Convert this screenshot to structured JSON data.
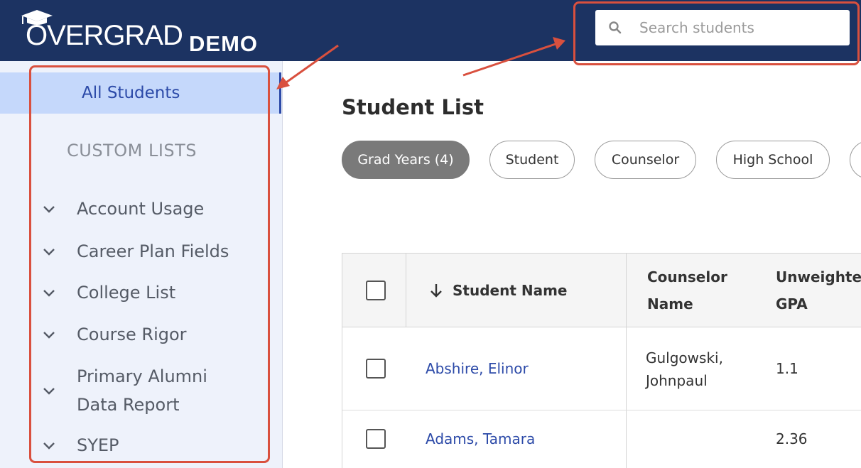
{
  "header": {
    "logo_letter": "O",
    "logo_text": "VERGRAD",
    "logo_suffix": "DEMO",
    "search_placeholder": "Search students",
    "background": "#1c3362"
  },
  "sidebar": {
    "selected_item": "All Students",
    "section_label": "CUSTOM LISTS",
    "items": [
      {
        "label": "Account Usage"
      },
      {
        "label": "Career Plan Fields"
      },
      {
        "label": "College List"
      },
      {
        "label": "Course Rigor"
      },
      {
        "label_line1": "Primary Alumni",
        "label_line2": "Data Report"
      },
      {
        "label": "SYEP"
      }
    ]
  },
  "main": {
    "title": "Student List",
    "filters": [
      "Grad Years (4)",
      "Student",
      "Counselor",
      "High School"
    ]
  },
  "table": {
    "columns": {
      "student_name": "Student Name",
      "counselor_line1": "Counselor",
      "counselor_line2": "Name",
      "gpa_line1": "Unweighted",
      "gpa_line2": "GPA"
    },
    "rows": [
      {
        "student": "Abshire, Elinor",
        "counselor_line1": "Gulgowski,",
        "counselor_line2": "Johnpaul",
        "gpa": "1.1"
      },
      {
        "student": "Adams, Tamara",
        "counselor_line1": "",
        "counselor_line2": "",
        "gpa": "2.36"
      }
    ]
  },
  "colors": {
    "accent": "#2c4aa8",
    "selected_bg": "#c5d8fb",
    "annotation": "#d9503e"
  }
}
